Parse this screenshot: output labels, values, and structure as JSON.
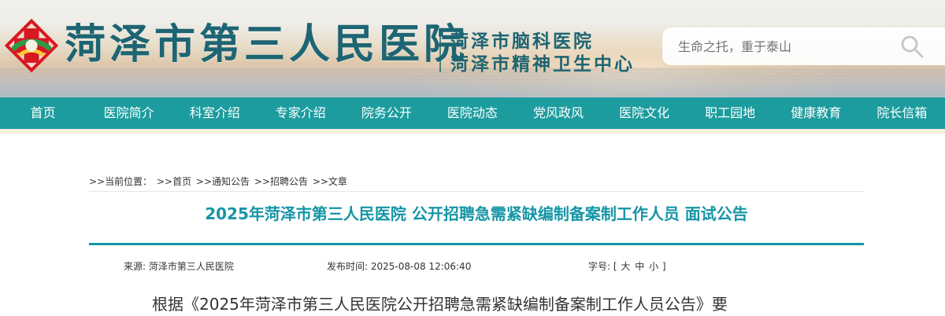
{
  "site": {
    "name": "菏泽市第三人民医院",
    "subnames": [
      "菏泽市脑科医院",
      "菏泽市精神卫生中心"
    ],
    "search": {
      "placeholder": "生命之托，重于泰山"
    }
  },
  "nav": {
    "items": [
      "首页",
      "医院简介",
      "科室介绍",
      "专家介绍",
      "院务公开",
      "医院动态",
      "党风政风",
      "医院文化",
      "职工园地",
      "健康教育",
      "院长信箱"
    ]
  },
  "breadcrumb": {
    "prefix": ">>当前位置：",
    "items": [
      ">>首页",
      ">>通知公告",
      ">>招聘公告",
      ">>文章"
    ]
  },
  "article": {
    "title": "2025年菏泽市第三人民医院 公开招聘急需紧缺编制备案制工作人员 面试公告",
    "meta": {
      "source_label": "来源:",
      "source": "菏泽市第三人民医院",
      "date_label": "发布时间:",
      "date": "2025-08-08 12:06:40",
      "size_label": "字号:",
      "size_open": "[",
      "size_big": "大",
      "size_mid": "中",
      "size_small": "小",
      "size_close": "]"
    },
    "intro": "根据《2025年菏泽市第三人民医院公开招聘急需紧缺编制备案制工作人员公告》要"
  },
  "colors": {
    "brand": "#1d6573",
    "nav_bg": "#1c9c9e",
    "title": "#1595a6",
    "cross": "#d71920"
  },
  "icons": {
    "logo": "hospital-cross-logo-icon",
    "search": "magnifier-icon"
  }
}
